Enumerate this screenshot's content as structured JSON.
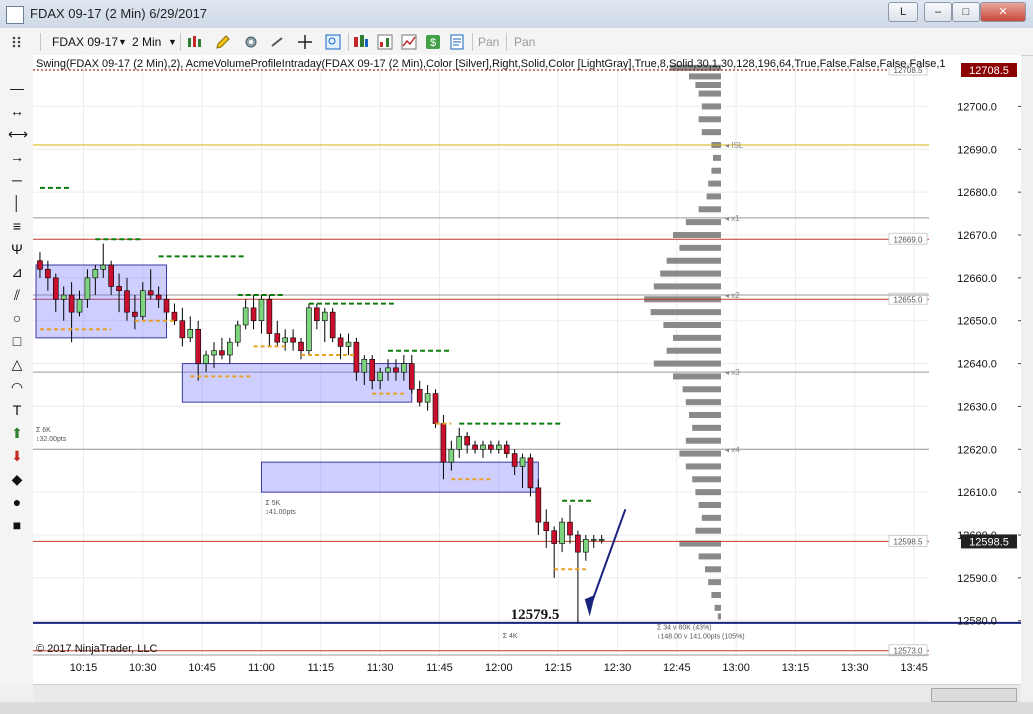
{
  "window": {
    "title": "FDAX 09-17 (2 Min)  6/29/2017",
    "min": "–",
    "max": "□",
    "close": "✕",
    "layout": "L"
  },
  "toolbar": {
    "instrument": "FDAX 09-17",
    "interval": "2 Min",
    "pan1": "Pan",
    "pan2": "Pan",
    "icons": [
      "bar-type-icon",
      "pencil-icon",
      "properties-icon",
      "crosshair-icon",
      "zoom-icon",
      "strategies-icon",
      "chart-trader-icon",
      "dollar-icon",
      "data-box-icon"
    ]
  },
  "drawing_tools": [
    "line-icon",
    "ray-icon",
    "extended-line-icon",
    "arrow-line-icon",
    "horizontal-line-icon",
    "vertical-line-icon",
    "fibonacci-icon",
    "andrews-pitchfork-icon",
    "gann-fan-icon",
    "regression-channel-icon",
    "ellipse-icon",
    "rectangle-icon",
    "triangle-icon",
    "arc-icon",
    "text-icon",
    "arrow-up-icon",
    "arrow-down-icon",
    "diamond-icon",
    "dot-icon",
    "square-icon"
  ],
  "colors": {
    "up": "#7ed37e",
    "down": "#c8102e",
    "wick": "#000000",
    "box": "#6a6aff",
    "profile": "#8a8a8a",
    "profile_light": "#7fd3e0",
    "swing": "#0a7d0a",
    "orange": "#e8a020",
    "last_price_bg": "#222222",
    "current_price_bg": "#8b0000",
    "level_line": "#1a237e"
  },
  "chart_data": {
    "type": "candlestick",
    "header": "Swing(FDAX 09-17 (2 Min),2), AcmeVolumeProfileIntraday(FDAX 09-17 (2 Min),Color [Silver],Right,Solid,Color [LightGray],True,8,Solid,30,1,30,128,196,64,True,False,False,False,False,1",
    "copyright": "© 2017 NinjaTrader, LLC",
    "ylim": [
      12572,
      12712
    ],
    "xlim_minutes": [
      603,
      828
    ],
    "y_ticks": [
      12580.0,
      12590.0,
      12600.0,
      12610.0,
      12620.0,
      12630.0,
      12640.0,
      12650.0,
      12660.0,
      12670.0,
      12680.0,
      12690.0,
      12700.0
    ],
    "y_tick_labels": [
      "12580.0",
      "12590.0",
      "12600.0",
      "12610.0",
      "12620.0",
      "12630.0",
      "12640.0",
      "12650.0",
      "12660.0",
      "12670.0",
      "12680.0",
      "12690.0",
      "12700.0"
    ],
    "x_tick_labels": [
      "10:15",
      "10:30",
      "10:45",
      "11:00",
      "11:15",
      "11:30",
      "11:45",
      "12:00",
      "12:15",
      "12:30",
      "12:45",
      "13:00",
      "13:15",
      "13:30",
      "13:45"
    ],
    "x_ticks_minutes": [
      615,
      630,
      645,
      660,
      675,
      690,
      705,
      720,
      735,
      750,
      765,
      780,
      795,
      810,
      825
    ],
    "candles": [
      {
        "t": 604,
        "o": 12664,
        "h": 12666,
        "l": 12660,
        "c": 12662
      },
      {
        "t": 606,
        "o": 12662,
        "h": 12664,
        "l": 12657,
        "c": 12660
      },
      {
        "t": 608,
        "o": 12660,
        "h": 12661,
        "l": 12652,
        "c": 12655
      },
      {
        "t": 610,
        "o": 12655,
        "h": 12658,
        "l": 12650,
        "c": 12656
      },
      {
        "t": 612,
        "o": 12656,
        "h": 12659,
        "l": 12645,
        "c": 12652
      },
      {
        "t": 614,
        "o": 12652,
        "h": 12657,
        "l": 12651,
        "c": 12655
      },
      {
        "t": 616,
        "o": 12655,
        "h": 12662,
        "l": 12653,
        "c": 12660
      },
      {
        "t": 618,
        "o": 12660,
        "h": 12663,
        "l": 12656,
        "c": 12662
      },
      {
        "t": 620,
        "o": 12662,
        "h": 12668,
        "l": 12660,
        "c": 12663
      },
      {
        "t": 622,
        "o": 12663,
        "h": 12664,
        "l": 12656,
        "c": 12658
      },
      {
        "t": 624,
        "o": 12658,
        "h": 12661,
        "l": 12652,
        "c": 12657
      },
      {
        "t": 626,
        "o": 12657,
        "h": 12660,
        "l": 12650,
        "c": 12652
      },
      {
        "t": 628,
        "o": 12652,
        "h": 12656,
        "l": 12648,
        "c": 12651
      },
      {
        "t": 630,
        "o": 12651,
        "h": 12659,
        "l": 12650,
        "c": 12657
      },
      {
        "t": 632,
        "o": 12657,
        "h": 12662,
        "l": 12655,
        "c": 12656
      },
      {
        "t": 634,
        "o": 12656,
        "h": 12658,
        "l": 12653,
        "c": 12655
      },
      {
        "t": 636,
        "o": 12655,
        "h": 12656,
        "l": 12650,
        "c": 12652
      },
      {
        "t": 638,
        "o": 12652,
        "h": 12654,
        "l": 12649,
        "c": 12650
      },
      {
        "t": 640,
        "o": 12650,
        "h": 12653,
        "l": 12644,
        "c": 12646
      },
      {
        "t": 642,
        "o": 12646,
        "h": 12651,
        "l": 12645,
        "c": 12648
      },
      {
        "t": 644,
        "o": 12648,
        "h": 12650,
        "l": 12636,
        "c": 12640
      },
      {
        "t": 646,
        "o": 12640,
        "h": 12643,
        "l": 12638,
        "c": 12642
      },
      {
        "t": 648,
        "o": 12642,
        "h": 12645,
        "l": 12639,
        "c": 12643
      },
      {
        "t": 650,
        "o": 12643,
        "h": 12646,
        "l": 12641,
        "c": 12642
      },
      {
        "t": 652,
        "o": 12642,
        "h": 12646,
        "l": 12640,
        "c": 12645
      },
      {
        "t": 654,
        "o": 12645,
        "h": 12650,
        "l": 12644,
        "c": 12649
      },
      {
        "t": 656,
        "o": 12649,
        "h": 12655,
        "l": 12648,
        "c": 12653
      },
      {
        "t": 658,
        "o": 12653,
        "h": 12656,
        "l": 12648,
        "c": 12650
      },
      {
        "t": 660,
        "o": 12650,
        "h": 12656,
        "l": 12647,
        "c": 12655
      },
      {
        "t": 662,
        "o": 12655,
        "h": 12656,
        "l": 12644,
        "c": 12647
      },
      {
        "t": 664,
        "o": 12647,
        "h": 12650,
        "l": 12644,
        "c": 12645
      },
      {
        "t": 666,
        "o": 12645,
        "h": 12648,
        "l": 12643,
        "c": 12646
      },
      {
        "t": 668,
        "o": 12646,
        "h": 12648,
        "l": 12643,
        "c": 12645
      },
      {
        "t": 670,
        "o": 12645,
        "h": 12646,
        "l": 12641,
        "c": 12643
      },
      {
        "t": 672,
        "o": 12643,
        "h": 12654,
        "l": 12642,
        "c": 12653
      },
      {
        "t": 674,
        "o": 12653,
        "h": 12654,
        "l": 12648,
        "c": 12650
      },
      {
        "t": 676,
        "o": 12650,
        "h": 12653,
        "l": 12645,
        "c": 12652
      },
      {
        "t": 678,
        "o": 12652,
        "h": 12653,
        "l": 12645,
        "c": 12646
      },
      {
        "t": 680,
        "o": 12646,
        "h": 12647,
        "l": 12641,
        "c": 12644
      },
      {
        "t": 682,
        "o": 12644,
        "h": 12647,
        "l": 12642,
        "c": 12645
      },
      {
        "t": 684,
        "o": 12645,
        "h": 12646,
        "l": 12636,
        "c": 12638
      },
      {
        "t": 686,
        "o": 12638,
        "h": 12642,
        "l": 12635,
        "c": 12641
      },
      {
        "t": 688,
        "o": 12641,
        "h": 12642,
        "l": 12634,
        "c": 12636
      },
      {
        "t": 690,
        "o": 12636,
        "h": 12639,
        "l": 12634,
        "c": 12638
      },
      {
        "t": 692,
        "o": 12638,
        "h": 12641,
        "l": 12636,
        "c": 12639
      },
      {
        "t": 694,
        "o": 12639,
        "h": 12641,
        "l": 12636,
        "c": 12638
      },
      {
        "t": 696,
        "o": 12638,
        "h": 12642,
        "l": 12636,
        "c": 12640
      },
      {
        "t": 698,
        "o": 12640,
        "h": 12642,
        "l": 12633,
        "c": 12634
      },
      {
        "t": 700,
        "o": 12634,
        "h": 12636,
        "l": 12630,
        "c": 12631
      },
      {
        "t": 702,
        "o": 12631,
        "h": 12635,
        "l": 12629,
        "c": 12633
      },
      {
        "t": 704,
        "o": 12633,
        "h": 12634,
        "l": 12625,
        "c": 12626
      },
      {
        "t": 706,
        "o": 12626,
        "h": 12628,
        "l": 12613,
        "c": 12617
      },
      {
        "t": 708,
        "o": 12617,
        "h": 12622,
        "l": 12615,
        "c": 12620
      },
      {
        "t": 710,
        "o": 12620,
        "h": 12625,
        "l": 12618,
        "c": 12623
      },
      {
        "t": 712,
        "o": 12623,
        "h": 12624,
        "l": 12619,
        "c": 12621
      },
      {
        "t": 714,
        "o": 12621,
        "h": 12622,
        "l": 12619,
        "c": 12620
      },
      {
        "t": 716,
        "o": 12620,
        "h": 12622,
        "l": 12618,
        "c": 12621
      },
      {
        "t": 718,
        "o": 12621,
        "h": 12622,
        "l": 12619,
        "c": 12620
      },
      {
        "t": 720,
        "o": 12620,
        "h": 12622,
        "l": 12619,
        "c": 12621
      },
      {
        "t": 722,
        "o": 12621,
        "h": 12622,
        "l": 12618,
        "c": 12619
      },
      {
        "t": 724,
        "o": 12619,
        "h": 12620,
        "l": 12614,
        "c": 12616
      },
      {
        "t": 726,
        "o": 12616,
        "h": 12619,
        "l": 12611,
        "c": 12618
      },
      {
        "t": 728,
        "o": 12618,
        "h": 12619,
        "l": 12609,
        "c": 12611
      },
      {
        "t": 730,
        "o": 12611,
        "h": 12613,
        "l": 12600,
        "c": 12603
      },
      {
        "t": 732,
        "o": 12603,
        "h": 12606,
        "l": 12597,
        "c": 12601
      },
      {
        "t": 734,
        "o": 12601,
        "h": 12602,
        "l": 12590,
        "c": 12598
      },
      {
        "t": 736,
        "o": 12598,
        "h": 12604,
        "l": 12596,
        "c": 12603
      },
      {
        "t": 738,
        "o": 12603,
        "h": 12607,
        "l": 12598,
        "c": 12600
      },
      {
        "t": 740,
        "o": 12600,
        "h": 12601,
        "l": 12579.5,
        "c": 12596
      },
      {
        "t": 742,
        "o": 12596,
        "h": 12600,
        "l": 12594,
        "c": 12599
      },
      {
        "t": 744,
        "o": 12599,
        "h": 12600,
        "l": 12597,
        "c": 12599
      },
      {
        "t": 746,
        "o": 12599,
        "h": 12600,
        "l": 12598,
        "c": 12599
      }
    ],
    "value_area_boxes": [
      {
        "t0": 603,
        "t1": 636,
        "low": 12646,
        "high": 12663
      },
      {
        "t0": 640,
        "t1": 698,
        "low": 12631,
        "high": 12640
      },
      {
        "t0": 660,
        "t1": 730,
        "low": 12610,
        "high": 12617
      }
    ],
    "swing_highs": [
      {
        "t0": 604,
        "t1": 612,
        "p": 12681
      },
      {
        "t0": 618,
        "t1": 630,
        "p": 12669
      },
      {
        "t0": 634,
        "t1": 656,
        "p": 12665
      },
      {
        "t0": 654,
        "t1": 666,
        "p": 12656
      },
      {
        "t0": 672,
        "t1": 694,
        "p": 12654
      },
      {
        "t0": 692,
        "t1": 708,
        "p": 12643
      },
      {
        "t0": 710,
        "t1": 736,
        "p": 12626
      },
      {
        "t0": 736,
        "t1": 744,
        "p": 12608
      }
    ],
    "swing_lows": [
      {
        "t0": 604,
        "t1": 622,
        "p": 12648
      },
      {
        "t0": 628,
        "t1": 638,
        "p": 12650
      },
      {
        "t0": 642,
        "t1": 658,
        "p": 12637
      },
      {
        "t0": 658,
        "t1": 666,
        "p": 12644
      },
      {
        "t0": 670,
        "t1": 684,
        "p": 12642
      },
      {
        "t0": 688,
        "t1": 696,
        "p": 12633
      },
      {
        "t0": 704,
        "t1": 708,
        "p": 12626
      },
      {
        "t0": 708,
        "t1": 718,
        "p": 12613
      },
      {
        "t0": 734,
        "t1": 742,
        "p": 12592
      }
    ],
    "horizontal_levels": [
      {
        "p": 12708.5,
        "label": "12708.5",
        "style": "dotted",
        "color": "#8b0000"
      },
      {
        "p": 12691,
        "label": "ISL",
        "style": "solid",
        "color": "#d4b000"
      },
      {
        "p": 12674,
        "label": "x1",
        "style": "solid",
        "color": "#999999"
      },
      {
        "p": 12669,
        "label": "12669.0",
        "style": "solid",
        "color": "#c0392b"
      },
      {
        "p": 12655,
        "label": "12655.0",
        "style": "solid",
        "color": "#c0392b"
      },
      {
        "p": 12656,
        "label": "x2",
        "style": "solid",
        "color": "#999999"
      },
      {
        "p": 12638,
        "label": "x3",
        "style": "solid",
        "color": "#999999"
      },
      {
        "p": 12620,
        "label": "x4",
        "style": "solid",
        "color": "#999999"
      },
      {
        "p": 12598.5,
        "label": "12598.5",
        "style": "solid",
        "color": "#c0392b"
      },
      {
        "p": 12573,
        "label": "12573.0",
        "style": "solid",
        "color": "#c0392b"
      }
    ],
    "blue_level": {
      "p": 12579.5,
      "label": "12579.5"
    },
    "last_price": "12598.5",
    "current_price": "12708.5",
    "annotations": [
      {
        "t": 603,
        "p": 12624,
        "lines": [
          "Σ 6K",
          "↕32.00pts"
        ]
      },
      {
        "t": 661,
        "p": 12607,
        "lines": [
          "Σ 5K",
          "↕41.00pts"
        ]
      },
      {
        "t": 721,
        "p": 12576,
        "lines": [
          "Σ 4K"
        ]
      },
      {
        "t": 760,
        "p": 12578,
        "lines": [
          "Σ 34 v 80K (43%)",
          "↕148.00 v 141.00pts (105%)"
        ]
      }
    ],
    "volume_profile": [
      [
        12709,
        32
      ],
      [
        12707,
        20
      ],
      [
        12705,
        16
      ],
      [
        12703,
        14
      ],
      [
        12700,
        12
      ],
      [
        12697,
        14
      ],
      [
        12694,
        12
      ],
      [
        12691,
        6
      ],
      [
        12688,
        5
      ],
      [
        12685,
        6
      ],
      [
        12682,
        8
      ],
      [
        12679,
        9
      ],
      [
        12676,
        14
      ],
      [
        12673,
        22
      ],
      [
        12670,
        30
      ],
      [
        12667,
        26
      ],
      [
        12664,
        34
      ],
      [
        12661,
        38
      ],
      [
        12658,
        42
      ],
      [
        12655,
        48
      ],
      [
        12652,
        44
      ],
      [
        12649,
        36
      ],
      [
        12646,
        30
      ],
      [
        12643,
        34
      ],
      [
        12640,
        42
      ],
      [
        12637,
        30
      ],
      [
        12634,
        24
      ],
      [
        12631,
        22
      ],
      [
        12628,
        20
      ],
      [
        12625,
        18
      ],
      [
        12622,
        22
      ],
      [
        12619,
        26
      ],
      [
        12616,
        22
      ],
      [
        12613,
        18
      ],
      [
        12610,
        16
      ],
      [
        12607,
        14
      ],
      [
        12604,
        12
      ],
      [
        12601,
        16
      ],
      [
        12598,
        26
      ],
      [
        12595,
        14
      ],
      [
        12592,
        10
      ],
      [
        12589,
        8
      ],
      [
        12586,
        6
      ],
      [
        12583,
        4
      ],
      [
        12581,
        2
      ]
    ]
  }
}
